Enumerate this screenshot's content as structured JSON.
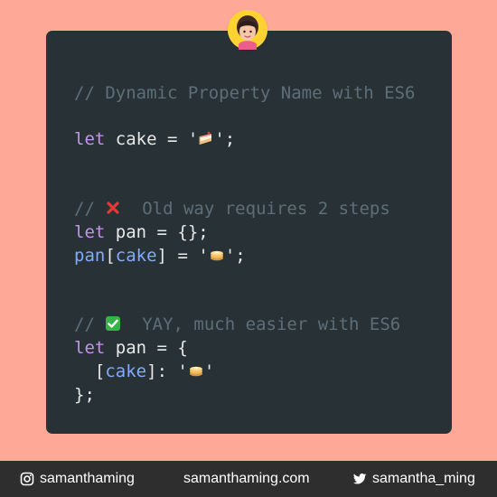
{
  "background_color": "#fea898",
  "avatar": {
    "icon": "woman-avatar-icon",
    "ring_color": "#ffd234"
  },
  "code_block": {
    "background_color": "#283236",
    "lines": {
      "line1_comment": "// Dynamic Property Name with ES6",
      "line2_keyword": "let",
      "line2_variable": "cake",
      "line2_operator": "=",
      "line2_quote_open": "'",
      "line2_quote_close": "';",
      "line3_comment_prefix": "//",
      "line3_comment_text": "Old way requires 2 steps",
      "line4_keyword": "let",
      "line4_rest": "pan = {};",
      "line5_object": "pan",
      "line5_bracket_open": "[",
      "line5_key": "cake",
      "line5_bracket_close": "]",
      "line5_operator": "=",
      "line5_quote_open": "'",
      "line5_quote_close": "';",
      "line6_comment_prefix": "//",
      "line6_comment_text": "YAY, much easier with ES6",
      "line7_keyword": "let",
      "line7_rest": "pan = {",
      "line8_indent": "  ",
      "line8_bracket_open": "[",
      "line8_key": "cake",
      "line8_bracket_close": "]",
      "line8_colon": ":",
      "line8_quote_open": "'",
      "line8_quote_close": "'",
      "line9_close": "};"
    },
    "icons": {
      "cake": "cake-icon",
      "cross": "cross-mark-icon",
      "check": "check-mark-icon",
      "pancake": "pancake-icon"
    },
    "colors": {
      "comment": "#5d6e78",
      "keyword": "#c792ea",
      "property": "#82aaff",
      "plain": "#e8e8e8",
      "cross_red": "#e53935",
      "check_green": "#36b24a"
    }
  },
  "footer": {
    "background_color": "#2e2e2e",
    "instagram": {
      "icon": "instagram-icon",
      "label": "samanthaming"
    },
    "website": {
      "label": "samanthaming.com"
    },
    "twitter": {
      "icon": "twitter-icon",
      "label": "samantha_ming"
    }
  }
}
